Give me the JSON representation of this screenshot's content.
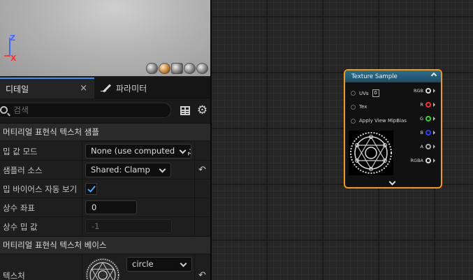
{
  "viewport": {
    "axis": {
      "z": "Z",
      "x": "X"
    },
    "preview_shapes": [
      "cylinder-icon",
      "sphere-icon",
      "plane-icon",
      "cube-icon",
      "teapot-icon"
    ]
  },
  "tabs": {
    "details": {
      "label": "디테일",
      "close": "×"
    },
    "parameters": {
      "label": "파라미터"
    }
  },
  "search": {
    "placeholder": "검색"
  },
  "sections": {
    "sampling": "머티리얼 표현식 텍스처 샘플",
    "texture_base": "머티리얼 표현식 텍스처 베이스"
  },
  "properties": {
    "mip_value_mode": {
      "label": "밉 값 모드",
      "value": "None (use computed mips)"
    },
    "sampler_source": {
      "label": "샘플러 소스",
      "value": "Shared: Clamp"
    },
    "auto_view_mip_bias": {
      "label": "밉 바이어스 자동 보기",
      "checked": true
    },
    "const_coordinate": {
      "label": "상수 좌표",
      "value": "0"
    },
    "const_mip_value": {
      "label": "상수 밉 값",
      "value": "-1"
    },
    "texture": {
      "label": "텍스처",
      "value": "circle"
    }
  },
  "node": {
    "title": "Texture Sample",
    "inputs": [
      {
        "label": "UVs",
        "value": "0"
      },
      {
        "label": "Tex"
      },
      {
        "label": "Apply View MipBias"
      }
    ],
    "outputs": [
      "RGB",
      "R",
      "G",
      "B",
      "A",
      "RGBA"
    ]
  },
  "colors": {
    "accent": "#3c91ff",
    "node_border": "#f09a10",
    "node_header": "#2f6e8e",
    "pin_r": "#ff2a2a",
    "pin_g": "#2ad92a",
    "pin_b": "#2a43ff"
  }
}
